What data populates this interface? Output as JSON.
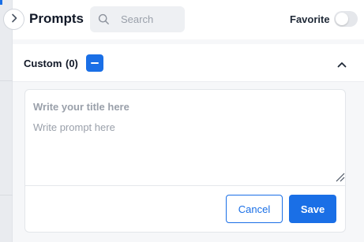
{
  "header": {
    "title": "Prompts",
    "search_placeholder": "Search",
    "favorite_label": "Favorite",
    "favorite_enabled": false
  },
  "section": {
    "title": "Custom",
    "count": "(0)",
    "expanded": true
  },
  "editor": {
    "title_placeholder": "Write your title here",
    "prompt_placeholder": "Write prompt here",
    "cancel_label": "Cancel",
    "save_label": "Save"
  },
  "icons": {
    "collapse_toggle": "chevron-right-icon",
    "search": "search-icon",
    "section_toggle": "chevron-up-icon",
    "collapse_section": "minus-icon",
    "resize": "resize-grip-icon"
  },
  "colors": {
    "accent": "#1a6fe6",
    "background": "#f3f4f6",
    "placeholder": "#9aa0aa"
  }
}
